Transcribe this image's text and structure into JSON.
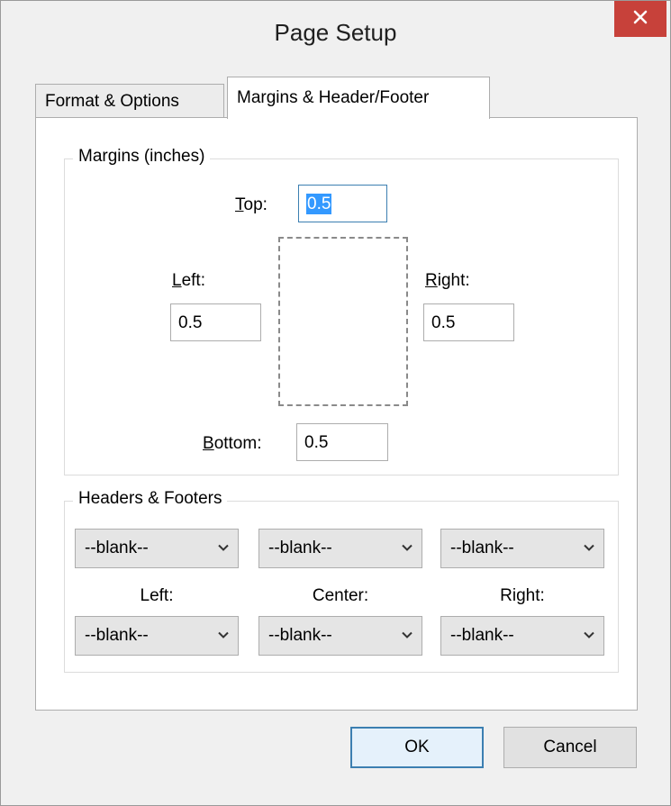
{
  "window": {
    "title": "Page Setup"
  },
  "tabs": [
    {
      "label": "Format & Options",
      "active": false
    },
    {
      "label": "Margins & Header/Footer",
      "active": true
    }
  ],
  "margins": {
    "group_title": "Margins (inches)",
    "top": {
      "label_underline": "T",
      "label_rest": "op:",
      "value": "0.5"
    },
    "left": {
      "label_underline": "L",
      "label_rest": "eft:",
      "value": "0.5"
    },
    "right": {
      "label_underline": "R",
      "label_rest": "ight:",
      "value": "0.5"
    },
    "bottom": {
      "label_underline": "B",
      "label_rest": "ottom:",
      "value": "0.5"
    }
  },
  "headers_footers": {
    "group_title": "Headers & Footers",
    "headers": [
      "--blank--",
      "--blank--",
      "--blank--"
    ],
    "labels": [
      "Left:",
      "Center:",
      "Right:"
    ],
    "footers": [
      "--blank--",
      "--blank--",
      "--blank--"
    ]
  },
  "buttons": {
    "ok": "OK",
    "cancel": "Cancel"
  },
  "icons": {
    "close": "close-icon",
    "chevron": "chevron-down-icon"
  },
  "colors": {
    "close_bg": "#c7413a",
    "focus_border": "#3c7fb1",
    "selection": "#3399ff"
  }
}
